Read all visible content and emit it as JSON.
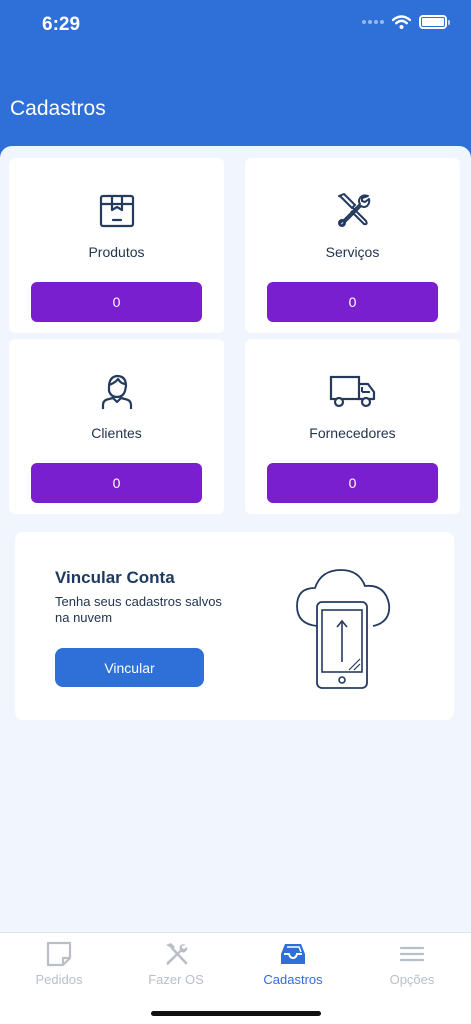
{
  "status_bar": {
    "time": "6:29"
  },
  "header": {
    "title": "Cadastros"
  },
  "cards": [
    {
      "label": "Produtos",
      "count": "0",
      "icon": "box-icon"
    },
    {
      "label": "Serviços",
      "count": "0",
      "icon": "tools-icon"
    },
    {
      "label": "Clientes",
      "count": "0",
      "icon": "person-icon"
    },
    {
      "label": "Fornecedores",
      "count": "0",
      "icon": "truck-icon"
    }
  ],
  "link_account": {
    "title": "Vincular Conta",
    "subtitle": "Tenha seus cadastros salvos na nuvem",
    "button_label": "Vincular",
    "icon": "cloud-phone-icon"
  },
  "tabbar": {
    "items": [
      {
        "label": "Pedidos",
        "icon": "note-icon",
        "active": false
      },
      {
        "label": "Fazer OS",
        "icon": "hammer-wrench-icon",
        "active": false
      },
      {
        "label": "Cadastros",
        "icon": "inbox-icon",
        "active": true
      },
      {
        "label": "Opções",
        "icon": "menu-icon",
        "active": false
      }
    ]
  },
  "colors": {
    "primary": "#2f6fd8",
    "count_button": "#7a1fd0",
    "tab_inactive": "#b9bec7",
    "tab_active": "#2f6fd8"
  }
}
